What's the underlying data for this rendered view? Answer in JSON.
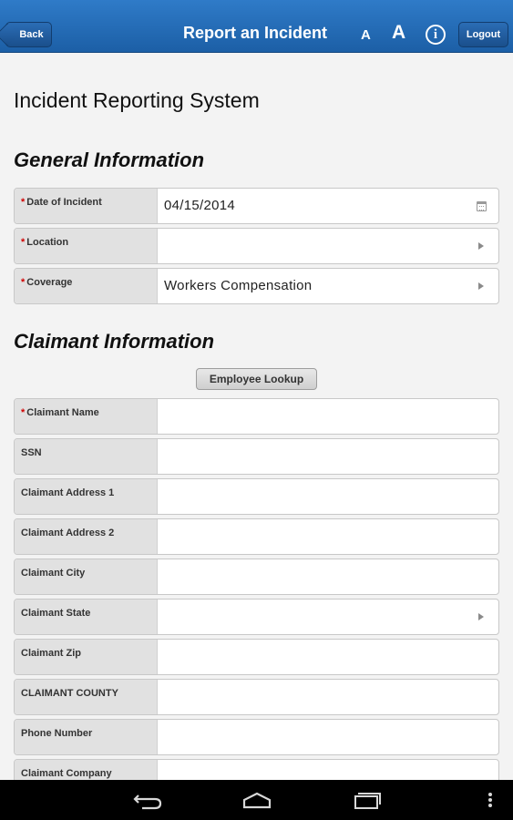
{
  "header": {
    "back_label": "Back",
    "title": "Report an Incident",
    "font_small_label": "A",
    "font_large_label": "A",
    "info_glyph": "i",
    "logout_label": "Logout"
  },
  "page_title": "Incident Reporting System",
  "general": {
    "title": "General Information",
    "fields": [
      {
        "label": "Date of Incident",
        "required": "*",
        "value": "04/15/2014",
        "icon": "calendar-icon"
      },
      {
        "label": "Location",
        "required": "*",
        "value": "",
        "icon": "chevron-right-icon"
      },
      {
        "label": "Coverage",
        "required": "*",
        "value": "Workers Compensation",
        "icon": "chevron-right-icon"
      }
    ]
  },
  "claimant": {
    "title": "Claimant Information",
    "lookup_label": "Employee Lookup",
    "fields": [
      {
        "label": "Claimant Name",
        "required": "*",
        "value": ""
      },
      {
        "label": "SSN",
        "value": ""
      },
      {
        "label": "Claimant Address 1",
        "value": ""
      },
      {
        "label": "Claimant Address 2",
        "value": ""
      },
      {
        "label": "Claimant City",
        "value": ""
      },
      {
        "label": "Claimant State",
        "value": "",
        "icon": "chevron-right-icon"
      },
      {
        "label": "Claimant Zip",
        "value": ""
      },
      {
        "label": "CLAIMANT COUNTY",
        "value": ""
      },
      {
        "label": "Phone Number",
        "value": ""
      },
      {
        "label": "Claimant Company",
        "value": ""
      }
    ]
  },
  "colors": {
    "header_blue": "#2f7bc8",
    "required_red": "#d00000",
    "label_bg": "#e1e1e1"
  },
  "navbar_icons": [
    "back-icon",
    "home-icon",
    "recent-apps-icon",
    "menu-icon"
  ]
}
